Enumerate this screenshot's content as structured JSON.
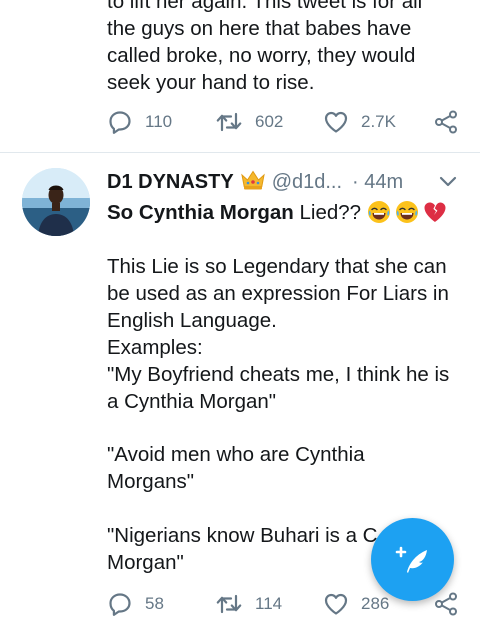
{
  "prev_tweet": {
    "body": "to lift her again. This tweet is for all\nthe guys on here that babes have\ncalled broke, no worry, they would\nseek your hand to rise.",
    "replies": "110",
    "retweets": "602",
    "likes": "2.7K"
  },
  "tweet": {
    "display_name": "D1 DYNASTY",
    "handle": "@d1d...",
    "time": "· 44m",
    "bold_lead": "So Cynthia Morgan",
    "lead_rest": " Lied?? ",
    "para2": "This Lie is so Legendary that she can\nbe used as an expression For Liars in\nEnglish Language.\nExamples:\n\"My Boyfriend cheats me, I think he is\na Cynthia Morgan\"",
    "para3": "\"Avoid men who are Cynthia\nMorgans\"",
    "para4": "\"Nigerians know Buhari is a C\nMorgan\"",
    "replies": "58",
    "retweets": "114",
    "likes": "286"
  },
  "icons": {
    "reply": "reply-icon",
    "retweet": "retweet-icon",
    "like": "heart-icon",
    "share": "share-icon",
    "compose": "compose-tweet-icon",
    "caret": "chevron-down-icon",
    "crown": "crown-emoji-icon"
  },
  "colors": {
    "accent": "#1da1f2",
    "muted": "#657786",
    "divider": "#e1e8ed"
  }
}
